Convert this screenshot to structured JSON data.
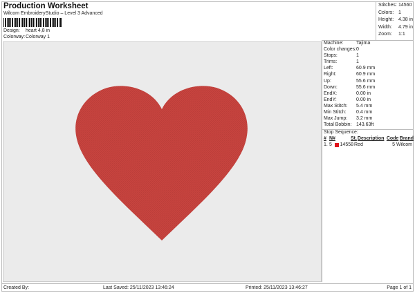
{
  "header": {
    "title": "Production Worksheet",
    "subtitle": "Wilcom EmbroideryStudio – Level 3 Advanced",
    "design_label": "Design:",
    "design_value": "heart 4,8 in",
    "colorway_label": "Colorway:",
    "colorway_value": "Colorway 1"
  },
  "stats": [
    {
      "label": "Stitches:",
      "value": "14560"
    },
    {
      "label": "Colors:",
      "value": "1"
    },
    {
      "label": "Height:",
      "value": "4.38 in"
    },
    {
      "label": "Width:",
      "value": "4.79 in"
    },
    {
      "label": "Zoom:",
      "value": "1:1"
    }
  ],
  "machine": [
    {
      "label": "Machine:",
      "value": "Tajima"
    },
    {
      "label": "Color changes:",
      "value": "0"
    },
    {
      "label": "Stops:",
      "value": "1"
    },
    {
      "label": "Trims:",
      "value": "1"
    },
    {
      "label": "Left:",
      "value": "60.9 mm"
    },
    {
      "label": "Right:",
      "value": "60.9 mm"
    },
    {
      "label": "Up:",
      "value": "55.6 mm"
    },
    {
      "label": "Down:",
      "value": "55.6 mm"
    },
    {
      "label": "EndX:",
      "value": "0.00 in"
    },
    {
      "label": "EndY:",
      "value": "0.00 in"
    },
    {
      "label": "Max Stitch:",
      "value": "5.4 mm"
    },
    {
      "label": "Min Stitch:",
      "value": "0.4 mm"
    },
    {
      "label": "Max Jump:",
      "value": "3.2 mm"
    },
    {
      "label": "Total Bobbin:",
      "value": "143.63ft"
    }
  ],
  "stop_sequence": {
    "title": "Stop Sequence:",
    "headers": [
      "#",
      "N#",
      "St.",
      "Description",
      "Code",
      "Brand"
    ],
    "rows": [
      {
        "num": "1.",
        "n": "5",
        "color": "#e0141c",
        "st": "14558",
        "description": "Red",
        "code": "5",
        "brand": "Wilcom"
      }
    ]
  },
  "design": {
    "heart_color": "#c7443f"
  },
  "footer": {
    "created": "Created By:",
    "saved": "Last Saved: 25/11/2023 13:46:24",
    "printed": "Printed: 25/11/2023 13:46:27",
    "page": "Page 1 of 1"
  }
}
